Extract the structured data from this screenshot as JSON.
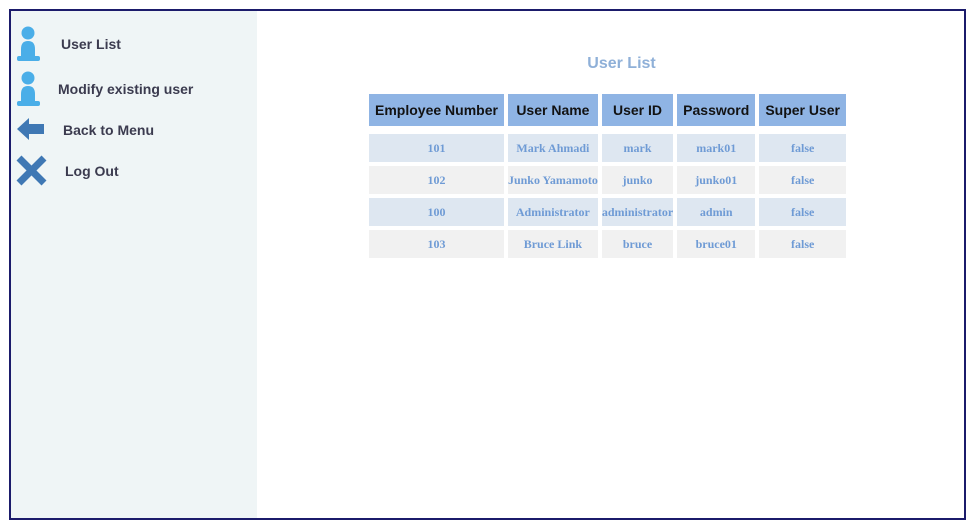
{
  "sidebar": {
    "items": [
      {
        "label": "User List",
        "icon": "user-icon"
      },
      {
        "label": "Modify existing user",
        "icon": "user-icon"
      },
      {
        "label": "Back to Menu",
        "icon": "arrow-left-icon"
      },
      {
        "label": "Log Out",
        "icon": "close-icon"
      }
    ]
  },
  "main": {
    "title": "User List",
    "table": {
      "columns": [
        "Employee Number",
        "User Name",
        "User ID",
        "Password",
        "Super User"
      ],
      "rows": [
        [
          "101",
          "Mark Ahmadi",
          "mark",
          "mark01",
          "false"
        ],
        [
          "102",
          "Junko Yamamoto",
          "junko",
          "junko01",
          "false"
        ],
        [
          "100",
          "Administrator",
          "administrator",
          "admin",
          "false"
        ],
        [
          "103",
          "Bruce Link",
          "bruce",
          "bruce01",
          "false"
        ]
      ]
    }
  },
  "colors": {
    "frame_border": "#1b1b6b",
    "sidebar_bg": "#eff5f6",
    "header_bg": "#8fb4e4",
    "row_alt_bg": "#dee7f1",
    "row_bg": "#f1f1f1",
    "cell_text": "#6f9bd5",
    "title_text": "#8fb0d8",
    "icon_blue": "#4aaee8",
    "icon_dark_blue": "#3f78b4"
  }
}
